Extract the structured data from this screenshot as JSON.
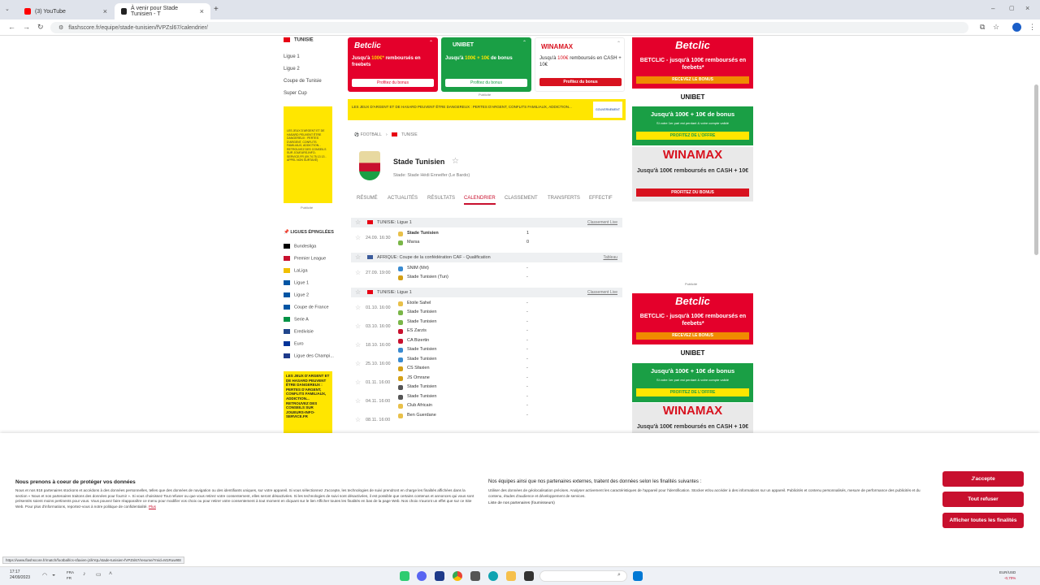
{
  "browser": {
    "tabs": [
      {
        "label": "(3) YouTube"
      },
      {
        "label": "À venir pour Stade Tunisien - T"
      }
    ],
    "url": "flashscore.fr/equipe/stade-tunisien/fVPZsl67/calendrier/"
  },
  "left": {
    "country": "TUNISIE",
    "leagues": [
      "Ligue 1",
      "Ligue 2",
      "Coupe de Tunisie",
      "Super Cup"
    ],
    "ad_text_1": "LES JEUX D'ARGENT ET DE HASARD PEUVENT ÊTRE DANGEREUX : PERTES D'ARGENT, CONFLITS FAMILIAUX, ADDICTION... RETROUVEZ DES CONSEILS SUR JOUEURS-INFO-SERVICE.FR (09 74 75 13 13 - APPEL NON SURTAXÉ)",
    "publicite": "Publicité",
    "pinned_title": "LIGUES ÉPINGLÉES",
    "pinned": [
      {
        "name": "Bundesliga",
        "color": "#000"
      },
      {
        "name": "Premier League",
        "color": "#c8102e"
      },
      {
        "name": "LaLiga",
        "color": "#f1bf00"
      },
      {
        "name": "Ligue 1",
        "color": "#0055a4"
      },
      {
        "name": "Ligue 2",
        "color": "#0055a4"
      },
      {
        "name": "Coupe de France",
        "color": "#0055a4"
      },
      {
        "name": "Serie A",
        "color": "#009246"
      },
      {
        "name": "Eredivisie",
        "color": "#21468b"
      },
      {
        "name": "Euro",
        "color": "#003399"
      },
      {
        "name": "Ligue des Champi...",
        "color": "#1e3a8a"
      }
    ],
    "ad_text_2": "LES JEUX D'ARGENT ET DE HASARD PEUVENT ÊTRE DANGEREUX : PERTES D'ARGENT, CONFLITS FAMILIAUX, ADDICTION... RETROUVEZ DES CONSEILS SUR JOUEURS-INFO-SERVICE.FR"
  },
  "ads": {
    "betclic": {
      "logo": "Betclic",
      "line1": "Jusqu'à",
      "amount": "100€*",
      "line2": "remboursés en freebets",
      "cta": "Profitez du bonus"
    },
    "unibet": {
      "logo": "UNIBET",
      "line1": "Jusqu'à",
      "amount": "100€ + 10€",
      "line2": "de bonus",
      "cta": "Profitez du bonus"
    },
    "winamax": {
      "logo": "WINAMAX",
      "line1": "Jusqu'à",
      "amount": "100€",
      "line2": "remboursés en CASH + 10€",
      "cta": "Profitez du bonus"
    },
    "publicite": "Publicité",
    "warning": "LES JEUX D'ARGENT ET DE HASARD PEUVENT ÊTRE DANGEREUX : PERTES D'ARGENT, CONFLITS FAMILIAUX, ADDICTION...",
    "gov": "GOUVERNEMENT"
  },
  "team": {
    "breadcrumb_sport": "FOOTBALL",
    "breadcrumb_country": "TUNISIE",
    "name": "Stade Tunisien",
    "stadium": "Stade: Stade Hédi Enneifer (Le Bardo)",
    "tabs": [
      "RÉSUMÉ",
      "ACTUALITÉS",
      "RÉSULTATS",
      "CALENDRIER",
      "CLASSEMENT",
      "TRANSFERTS",
      "EFFECTIF"
    ]
  },
  "groups": [
    {
      "title": "TUNISIE: Ligue 1",
      "link": "Classement Live",
      "matches": [
        {
          "date": "24.09. 16:30",
          "home": "Stade Tunisien",
          "away": "Marsa",
          "sh": "1",
          "sa": "0"
        }
      ]
    },
    {
      "title": "AFRIQUE: Coupe de la confédération CAF - Qualification",
      "link": "Tableau",
      "matches": [
        {
          "date": "27.09. 19:00",
          "home": "SNIM (Mrt)",
          "away": "Stade Tunisien (Tun)",
          "sh": "-",
          "sa": "-"
        }
      ]
    },
    {
      "title": "TUNISIE: Ligue 1",
      "link": "Classement Live",
      "matches": [
        {
          "date": "01.10. 16:00",
          "home": "Etoile Sahel",
          "away": "Stade Tunisien",
          "sh": "-",
          "sa": "-"
        },
        {
          "date": "03.10. 16:00",
          "home": "Stade Tunisien",
          "away": "ES Zarzis",
          "sh": "-",
          "sa": "-"
        },
        {
          "date": "18.10. 16:00",
          "home": "CA Bizertin",
          "away": "Stade Tunisien",
          "sh": "-",
          "sa": "-"
        },
        {
          "date": "25.10. 16:00",
          "home": "Stade Tunisien",
          "away": "CS Sfaxien",
          "sh": "-",
          "sa": "-"
        },
        {
          "date": "01.11. 16:00",
          "home": "JS Omrane",
          "away": "Stade Tunisien",
          "sh": "-",
          "sa": "-"
        },
        {
          "date": "04.11. 16:00",
          "home": "Stade Tunisien",
          "away": "Club Africain",
          "sh": "-",
          "sa": "-"
        },
        {
          "date": "08.11. 16:00",
          "home": "Ben Guerdane",
          "away": "",
          "sh": "-",
          "sa": ""
        }
      ]
    }
  ],
  "right": {
    "betclic_logo": "Betclic",
    "betclic_text": "BETCLIC - jusqu'à 100€ remboursés en feebets*",
    "betclic_cta": "RECEVEZ LE BONUS",
    "unibet_logo": "UNIBET",
    "unibet_text": "Jusqu'à 100€ + 10€ de bonus",
    "unibet_sub": "Si votre 1er pari est perdant & votre compte validé",
    "unibet_cta": "PROFITEZ DE L'OFFRE",
    "winamax_logo": "WINAMAX",
    "winamax_text": "Jusqu'à 100€ remboursés en CASH + 10€",
    "winamax_cta": "PROFITEZ DU BONUS",
    "publicite": "Publicité"
  },
  "cookie": {
    "title1": "Nous prenons à coeur de protéger vos données",
    "body1": "Nous et nos 918 partenaires stockons et accédons à des données personnelles, telles que des données de navigation ou des identifiants uniques, sur votre appareil. Si vous sélectionnez J'accepte, les technologies de suivi prendront en charge les finalités affichées dans la section « Nous et nos partenaires traitons des données pour fournir ». Si vous choisissez Tout refuser ou que vous retirez votre consentement, elles seront désactivées. Si les technologies de suivi sont désactivées, il est possible que certains contenus et annonces qui vous sont présentés soient moins pertinents pour vous. Vous pouvez faire réapparaître ce menu pour modifier vos choix ou pour retirer votre consentement à tout moment en cliquant sur le lien Afficher toutes les finalités en bas de la page Web. Nos choix n'auront un effet que sur ce Site Web. Pour plus d'informations, reportez-vous à notre politique de confidentialité.",
    "more": "Plus",
    "title2": "Nos équipes ainsi que nos partenaires externes, traitent des données selon les finalités suivantes :",
    "body2": "Utiliser des données de géolocalisation précises. Analyser activement les caractéristiques de l'appareil pour l'identification. Stocker et/ou accéder à des informations sur un appareil. Publicités et contenu personnalisés, mesure de performance des publicités et du contenu, études d'audience et développement de services.",
    "partners": "Liste de nos partenaires (fournisseurs)",
    "accept": "J'accepte",
    "refuse": "Tout refuser",
    "show": "Afficher toutes les finalités"
  },
  "status_url": "https://www.flashscore.fr/match/football/cs-sfaxien-j1lkYqL/stade-tunisien-fVPZsl67/resume/?mid=M1Ruw9t8",
  "taskbar": {
    "time": "17:17",
    "date": "24/09/2023",
    "lang": "FRA",
    "lang2": "FR",
    "currency": "EUR/USD",
    "change": "-0,70%"
  },
  "colors": {
    "brand_red": "#c8102e",
    "betclic_red": "#e4002b",
    "unibet_green": "#1a9f45",
    "winamax_red": "#d8121f",
    "warn_yellow": "#ffe600"
  }
}
